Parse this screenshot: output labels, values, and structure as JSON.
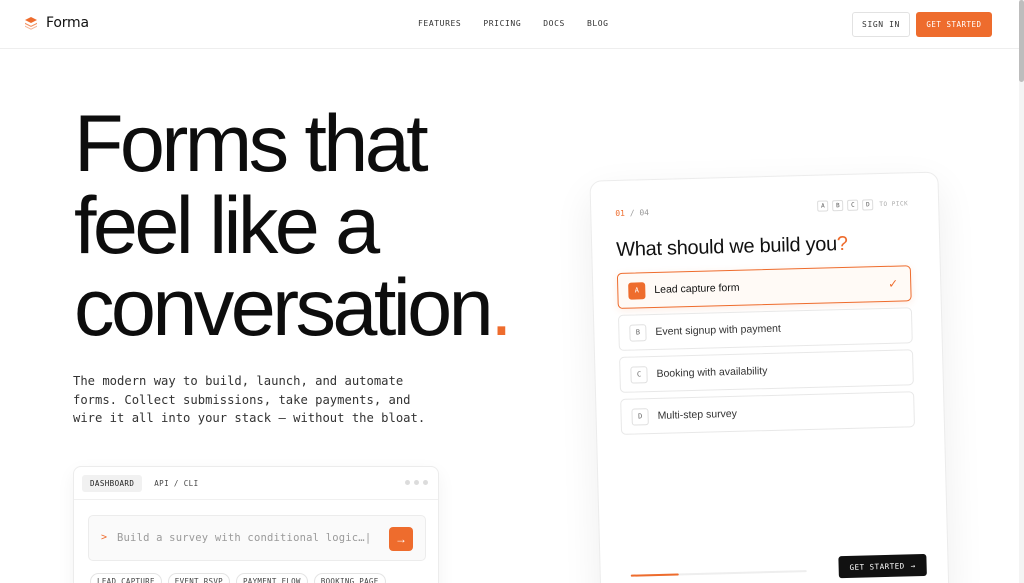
{
  "nav": {
    "brand": "Forma",
    "links": [
      "FEATURES",
      "PRICING",
      "DOCS",
      "BLOG"
    ],
    "signin": "SIGN IN",
    "cta": "GET STARTED"
  },
  "hero": {
    "line1": "Forms that",
    "line2": "feel like a",
    "line3": "conversation",
    "period": ".",
    "subtitle": "The modern way to build, launch, and automate forms. Collect submissions, take payments, and wire it all into your stack — without the bloat."
  },
  "widget": {
    "tabs": [
      "DASHBOARD",
      "API / CLI"
    ],
    "prompt_caret": ">",
    "prompt_text": "Build a survey with conditional logic…|",
    "send_icon": "→",
    "chips": [
      "LEAD CAPTURE",
      "EVENT RSVP",
      "PAYMENT FLOW",
      "BOOKING PAGE"
    ]
  },
  "card": {
    "step_current": "01",
    "step_sep": " / ",
    "step_total": "04",
    "keys": [
      "A",
      "B",
      "C",
      "D"
    ],
    "pick_hint": "TO PICK",
    "question": "What should we build you",
    "question_mark": "?",
    "options": [
      {
        "key": "A",
        "label": "Lead capture form",
        "selected": true
      },
      {
        "key": "B",
        "label": "Event signup with payment",
        "selected": false
      },
      {
        "key": "C",
        "label": "Booking with availability",
        "selected": false
      },
      {
        "key": "D",
        "label": "Multi-step survey",
        "selected": false
      }
    ],
    "check_icon": "✓",
    "progress": 0.27,
    "cta": "GET STARTED",
    "cta_icon": "→"
  },
  "colors": {
    "accent": "#ee6c2d",
    "dark": "#111111"
  }
}
